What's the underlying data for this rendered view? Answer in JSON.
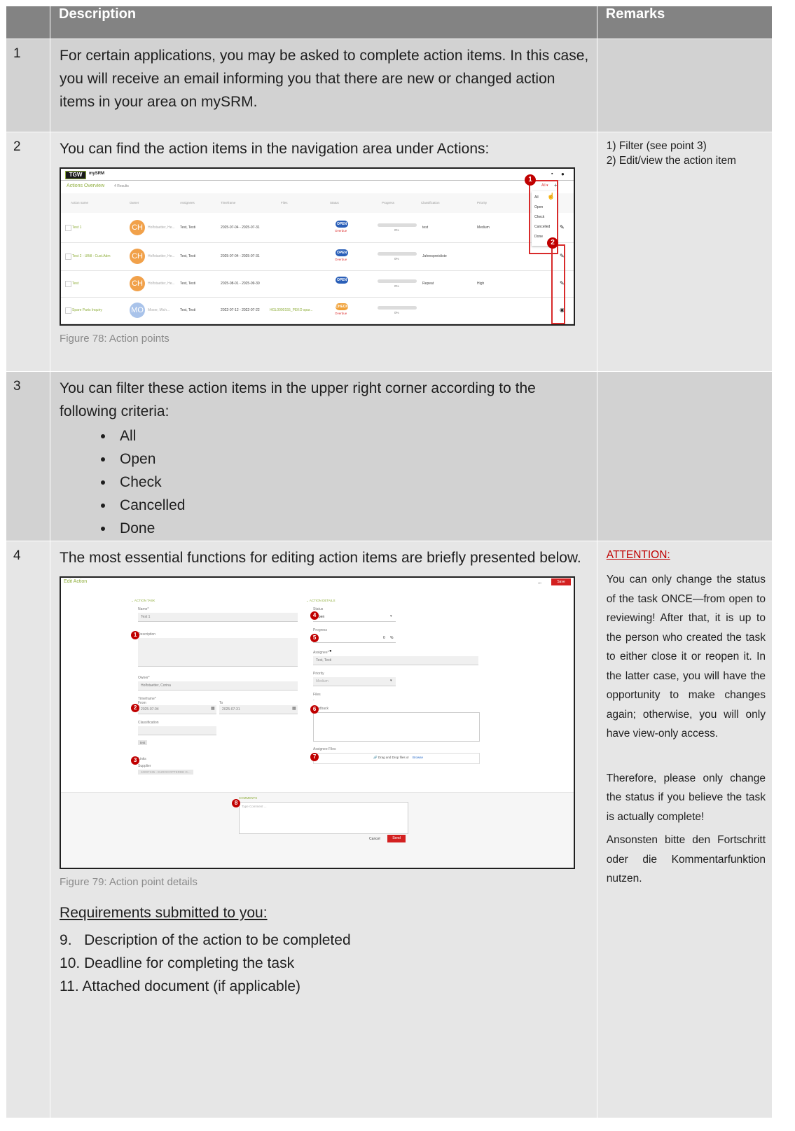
{
  "header": {
    "description": "Description",
    "remarks": "Remarks"
  },
  "rows": [
    {
      "num": "1",
      "text": "For certain applications, you may be asked to complete action items. In this case, you will receive an email informing you that there are new or changed action items in your area on mySRM."
    },
    {
      "num": "2",
      "text": "You can find the action items in the navigation area under Actions:",
      "caption": "Figure 78: Action points",
      "remark_1": "1) Filter (see point 3)",
      "remark_2": "2) Edit/view the action item"
    },
    {
      "num": "3",
      "text": "You can filter these action items in the upper right corner according to the following criteria:",
      "bullets": [
        "All",
        "Open",
        "Check",
        "Cancelled",
        "Done"
      ]
    },
    {
      "num": "4",
      "text": "The most essential functions for editing action items are briefly presented below.",
      "caption": "Figure 79: Action point details",
      "req_heading": "Requirements submitted to you:",
      "requirements": [
        "9.   Description of the action to be completed",
        "10. Deadline for completing the task",
        "11. Attached document (if applicable)"
      ],
      "attention": "ATTENTION:",
      "remark_a": "You can only change the status of the task ONCE—from open to reviewing! After that, it is up to the person who created the task to either close it or reopen it. In the latter case, you will have the opportunity to make changes again; otherwise, you will only have view-only access.",
      "remark_b": "Therefore, please only change the status if you believe the task is actually complete!",
      "remark_c": "Ansonsten bitte den Fortschritt oder die Kommentarfunktion nutzen."
    }
  ],
  "shot1": {
    "logo": "TGW",
    "app": "mySRM",
    "title": "Actions Overview",
    "results": "4 Results",
    "filter": "All ▾",
    "columns": [
      "Action name",
      "Owner",
      "Assignees",
      "Timeframe",
      "Files",
      "Status",
      "Progress",
      "Classification",
      "Priority"
    ],
    "menu": [
      "All",
      "Open",
      "Check",
      "Cancelled",
      "Done"
    ],
    "rows": [
      {
        "name": "Test 1",
        "initials": "CH",
        "owner": "Holfstaetter, He...",
        "assignee": "Test, Testi",
        "timeframe": "2025-07-04 - 2025-07-31",
        "files": "",
        "status": "OPEN",
        "overdue": "Overdue",
        "progress": "0%",
        "classification": "test",
        "priority": "Medium",
        "action": "edit"
      },
      {
        "name": "Test 2 - UBill - Cust.Adm",
        "initials": "CH",
        "owner": "Holfstaetter, He...",
        "assignee": "Test, Testi",
        "timeframe": "2025-07-04 - 2025-07-31",
        "files": "",
        "status": "OPEN",
        "overdue": "Overdue",
        "progress": "0%",
        "classification": "Jahrespreisliste",
        "priority": "",
        "action": "edit"
      },
      {
        "name": "Test",
        "initials": "CH",
        "owner": "Holfstaetter, He...",
        "assignee": "Test, Testi",
        "timeframe": "2025-08-01 - 2025-09-30",
        "files": "",
        "status": "OPEN",
        "overdue": "",
        "progress": "0%",
        "classification": "Repeat",
        "priority": "High",
        "action": "edit"
      },
      {
        "name": "Spare Parts Inquiry",
        "initials": "MO",
        "owner": "Moser, Mich...",
        "assignee": "Test, Testi",
        "timeframe": "2022-07-12 - 2022-07-22",
        "files": "HGL0000155_PEKO spar...",
        "status": "CHECK",
        "overdue": "Overdue",
        "progress": "0%",
        "classification": "",
        "priority": "",
        "action": "view"
      }
    ],
    "badges": [
      "1",
      "2"
    ]
  },
  "shot2": {
    "title": "Edit Action",
    "back": "←",
    "save": "Save",
    "section_task": "ACTION TASK",
    "section_details": "ACTION DETAILS",
    "name_label": "Name*",
    "name_value": "Test 1",
    "description_label": "Description",
    "owner_label": "Owner*",
    "owner_value": "Holfstaetter, Corina",
    "timeframe_label": "Timeframe*",
    "from_label": "From",
    "to_label": "To",
    "from_value": "2025-07-04",
    "to_value": "2025-07-31",
    "classification_label": "Classification",
    "classification_tag": "test",
    "links_label": "Links",
    "supplier_label": "Supplier",
    "supplier_value": "10007135 - EUROCOPTERDE G...",
    "status_label": "Status",
    "status_value": "Open",
    "progress_label": "Progress",
    "progress_value": "0",
    "progress_unit": "%",
    "assignee_label": "Assignee*",
    "assignee_value": "Test, Testi",
    "priority_label": "Priority",
    "priority_value": "Medium",
    "files_label": "Files",
    "files_value": "-",
    "feedback_label": "Feedback",
    "assignee_files_label": "Assignee Files",
    "drop_text": "Drag and Drop files or ",
    "browse": "Browse",
    "comments_label": "COMMENTS",
    "comment_placeholder": "Type Comment ...",
    "cancel": "Cancel",
    "send": "Send",
    "badges": [
      "1",
      "2",
      "3",
      "4",
      "5",
      "6",
      "7",
      "8"
    ]
  },
  "colors": {
    "header": "#838383",
    "row_light": "#e6e6e6",
    "row_dark": "#d2d2d2",
    "accent_red": "#c00000",
    "tgw_green": "#8fae3c",
    "open_blue": "#2a5fb8",
    "check_orange": "#f0a23a"
  }
}
